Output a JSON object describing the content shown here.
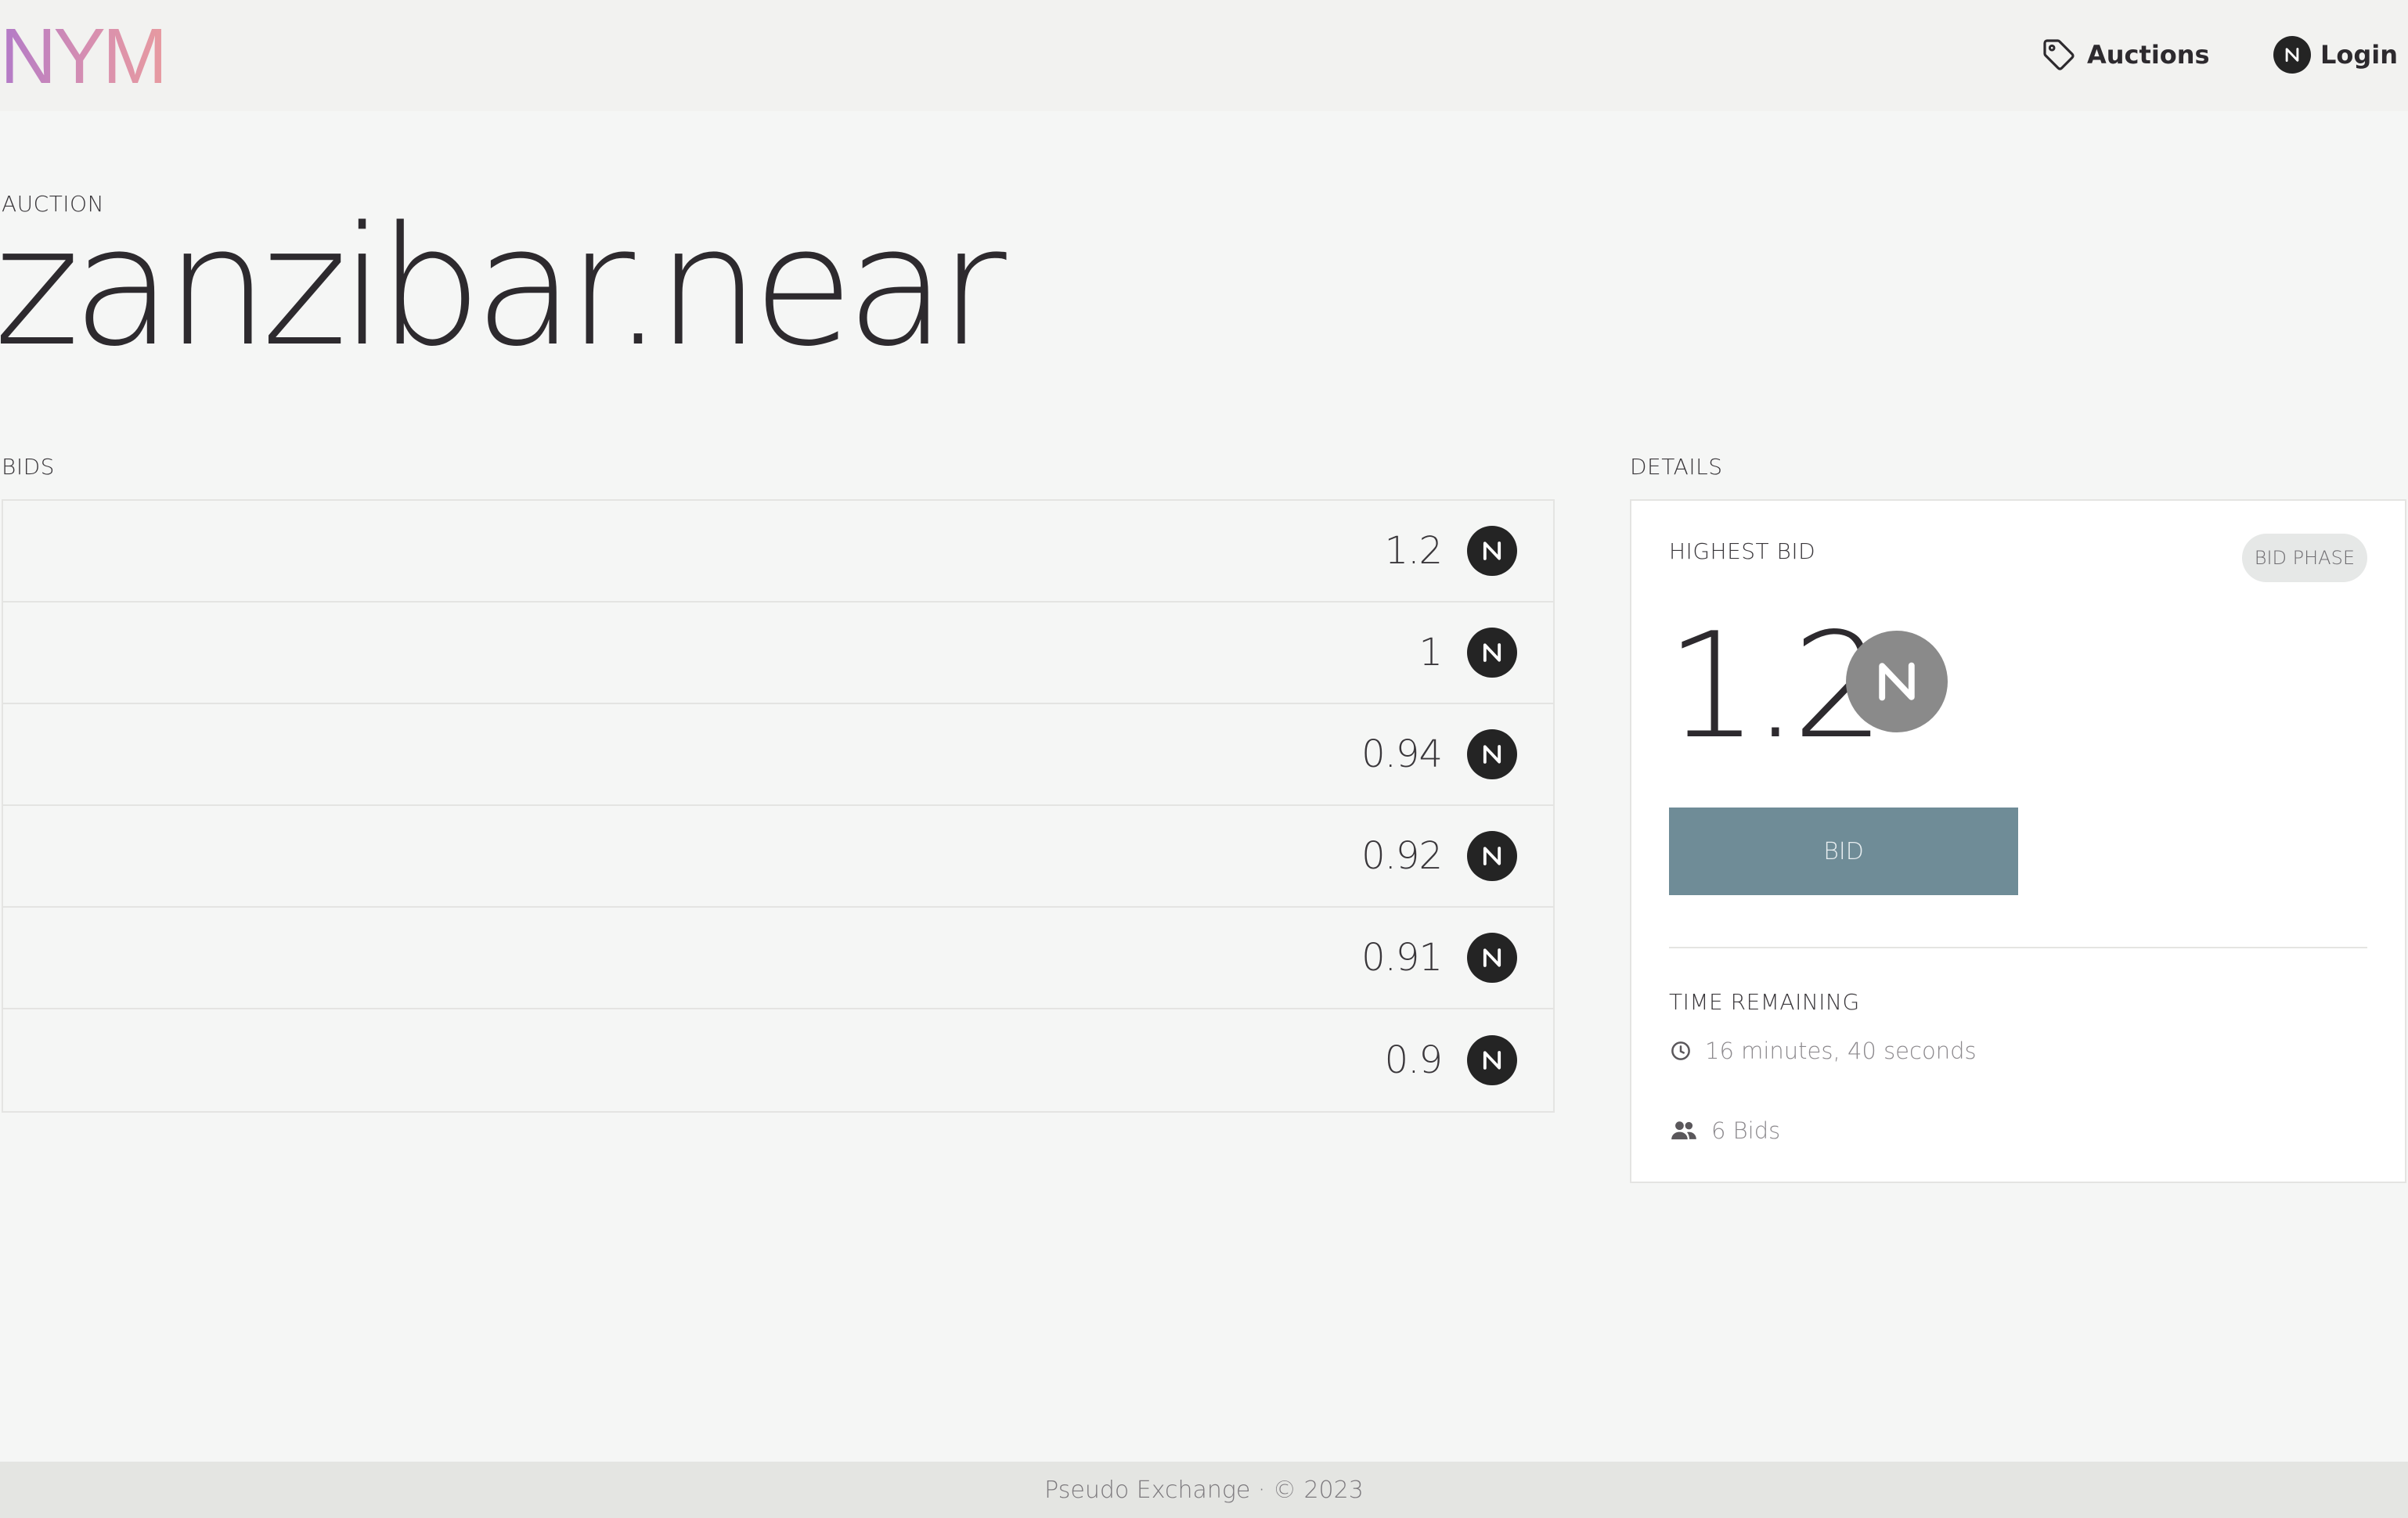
{
  "header": {
    "logo_text": "NYM",
    "nav": {
      "auctions_label": "Auctions",
      "auctions_icon": "tag-icon",
      "login_label": "Login",
      "login_icon": "near-icon"
    }
  },
  "auction": {
    "eyebrow": "AUCTION",
    "name": "zanzibar.near"
  },
  "bids": {
    "heading": "BIDS",
    "currency_icon": "near-icon",
    "items": [
      {
        "amount": "1.2"
      },
      {
        "amount": "1"
      },
      {
        "amount": "0.94"
      },
      {
        "amount": "0.92"
      },
      {
        "amount": "0.91"
      },
      {
        "amount": "0.9"
      }
    ]
  },
  "details": {
    "heading": "DETAILS",
    "highest_bid_label": "HIGHEST BID",
    "phase_badge": "BID PHASE",
    "highest_bid_value": "1.2",
    "bid_button_label": "BID",
    "time_remaining_label": "TIME REMAINING",
    "time_remaining_value": "16 minutes, 40 seconds",
    "time_icon": "clock-icon",
    "bid_count": "6 Bids",
    "bid_count_icon": "people-icon"
  },
  "footer": {
    "text": "Pseudo Exchange · © 2023"
  },
  "colors": {
    "page_background": "#f5f6f5",
    "header_background": "#f2f2f0",
    "footer_background": "#e4e5e2",
    "bid_button": "#6f8c97",
    "near_badge_dark": "#242424",
    "near_badge_grey": "#8a8a8a",
    "logo_gradient_start": "#b27ac8",
    "logo_gradient_end": "#e79aa0"
  }
}
